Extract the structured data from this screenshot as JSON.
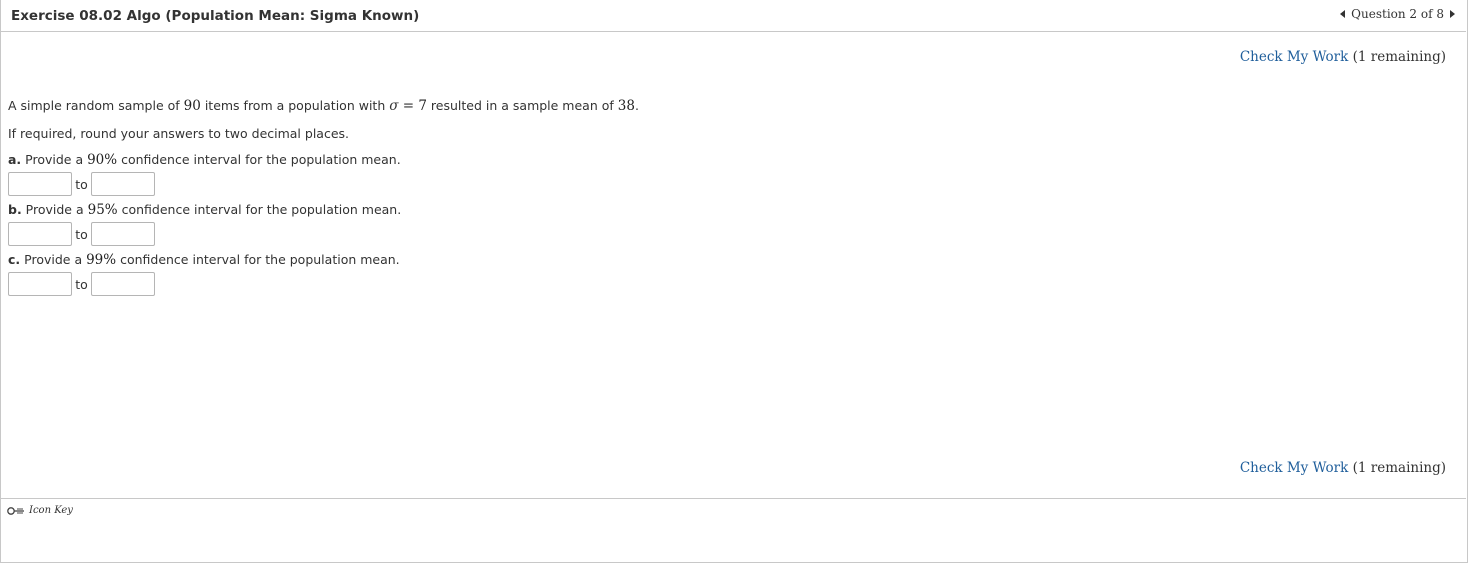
{
  "header": {
    "title": "Exercise 08.02 Algo (Population Mean: Sigma Known)",
    "question_nav": "Question 2 of 8"
  },
  "check_my_work": {
    "link": "Check My Work",
    "remaining": "(1 remaining)"
  },
  "problem": {
    "intro_1": "A simple random sample of ",
    "n": "90",
    "intro_2": " items from a population with ",
    "sigma_symbol": "σ",
    "equals": " = ",
    "sigma_value": "7",
    "intro_3": " resulted in a sample mean of ",
    "mean": "38",
    "intro_4": ".",
    "instruction": "If required, round your answers to two decimal places."
  },
  "parts": [
    {
      "letter": "a.",
      "prefix": " Provide a ",
      "level": "90%",
      "suffix": " confidence interval for the population mean.",
      "lower_value": "",
      "to": "to",
      "upper_value": ""
    },
    {
      "letter": "b.",
      "prefix": " Provide a ",
      "level": "95%",
      "suffix": " confidence interval for the population mean.",
      "lower_value": "",
      "to": "to",
      "upper_value": ""
    },
    {
      "letter": "c.",
      "prefix": " Provide a ",
      "level": "99%",
      "suffix": " confidence interval for the population mean.",
      "lower_value": "",
      "to": "to",
      "upper_value": ""
    }
  ],
  "footer": {
    "icon_key": "Icon Key",
    "icon": "key-icon"
  }
}
